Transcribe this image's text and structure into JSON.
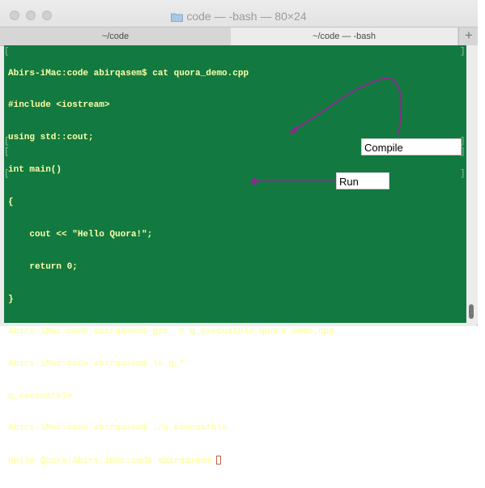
{
  "window": {
    "title": "code — -bash — 80×24",
    "tabs": [
      {
        "label": "~/code"
      },
      {
        "label": "~/code — -bash"
      }
    ],
    "new_tab": "+"
  },
  "terminal": {
    "lines": [
      "Abirs-iMac:code abirqasem$ cat quora_demo.cpp",
      "#include <iostream>",
      "using std::cout;",
      "int main()",
      "{",
      "    cout << \"Hello Quora!\";",
      "    return 0;",
      "}",
      "Abirs-iMac:code abirqasem$ g++ -o q_execuatble quora_demo.cpp",
      "Abirs-iMac:code abirqasem$ ls q_*",
      "q_execuatble",
      "Abirs-iMac:code abirqasem$ ./q_execuatble",
      "Hello Quora!Abirs-iMac:code abirqasem$ "
    ],
    "background": "#127a40",
    "text_color": "#ffffaa"
  },
  "annotations": {
    "compile": "Compile",
    "run": "Run",
    "arrow_color": "#8b2a8c"
  }
}
